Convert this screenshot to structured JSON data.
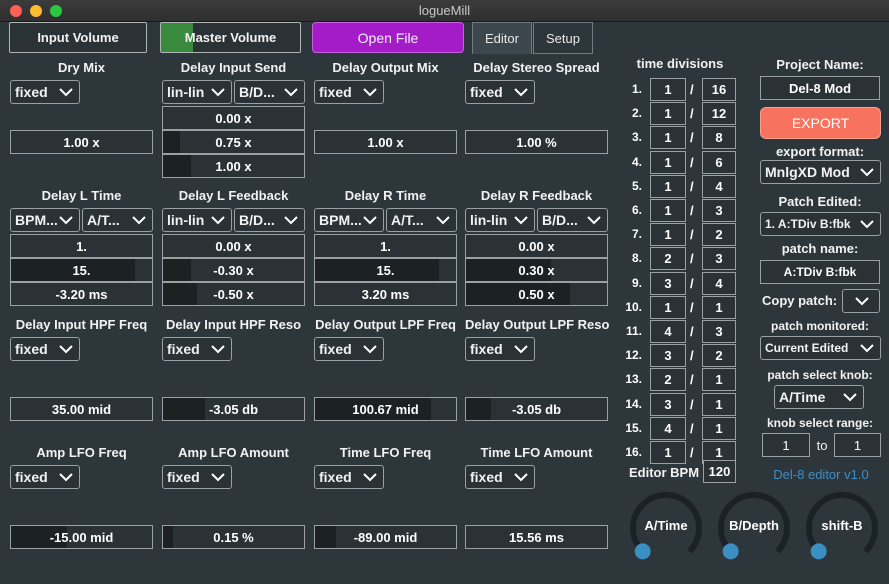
{
  "window": {
    "title": "logueMill"
  },
  "colors": {
    "open_file": "#a31cc8",
    "export": "#f7735e",
    "version": "#3d8ec9",
    "knob_dot": "#3b8fc2",
    "volume_fill": "#3a8a3e"
  },
  "toolbar": {
    "input_volume": "Input Volume",
    "master_volume": "Master Volume",
    "master_volume_level": 0.23,
    "open_file": "Open File",
    "tabs": [
      "Editor",
      "Setup"
    ]
  },
  "params": {
    "dry_mix": {
      "label": "Dry Mix",
      "mode": "fixed",
      "value": "1.00 x"
    },
    "delay_input_send": {
      "label": "Delay Input Send",
      "mode": "lin-lin",
      "mode2": "B/D...",
      "values": [
        "0.00 x",
        "0.75 x",
        "1.00 x"
      ],
      "levels": [
        0.0,
        0.12,
        0.2
      ]
    },
    "delay_output_mix": {
      "label": "Delay Output Mix",
      "mode": "fixed",
      "value": "1.00 x"
    },
    "delay_stereo_spread": {
      "label": "Delay Stereo Spread",
      "mode": "fixed",
      "value": "1.00 %"
    },
    "delay_l_time": {
      "label": "Delay L Time",
      "mode": "BPM...",
      "mode2": "A/T...",
      "values": [
        "1.",
        "15.",
        "-3.20 ms"
      ],
      "levels": [
        0.0,
        0.88,
        0.0
      ]
    },
    "delay_l_feedback": {
      "label": "Delay L Feedback",
      "mode": "lin-lin",
      "mode2": "B/D...",
      "values": [
        "0.00 x",
        "-0.30 x",
        "-0.50 x"
      ],
      "levels": [
        0.0,
        0.2,
        0.24
      ]
    },
    "delay_r_time": {
      "label": "Delay R Time",
      "mode": "BPM...",
      "mode2": "A/T...",
      "values": [
        "1.",
        "15.",
        "3.20 ms"
      ],
      "levels": [
        0.0,
        0.88,
        0.0
      ]
    },
    "delay_r_feedback": {
      "label": "Delay R Feedback",
      "mode": "lin-lin",
      "mode2": "B/D...",
      "values": [
        "0.00 x",
        "0.30 x",
        "0.50 x"
      ],
      "levels": [
        0.0,
        0.6,
        0.74
      ]
    },
    "delay_input_hpf_freq": {
      "label": "Delay Input HPF Freq",
      "mode": "fixed",
      "value": "35.00 mid"
    },
    "delay_input_hpf_reso": {
      "label": "Delay Input HPF Reso",
      "mode": "fixed",
      "value": "-3.05 db"
    },
    "delay_output_lpf_freq": {
      "label": "Delay Output LPF Freq",
      "mode": "fixed",
      "value": "100.67 mid"
    },
    "delay_output_lpf_reso": {
      "label": "Delay Output LPF Reso",
      "mode": "fixed",
      "value": "-3.05 db"
    },
    "amp_lfo_freq": {
      "label": "Amp LFO Freq",
      "mode": "fixed",
      "value": "-15.00 mid"
    },
    "amp_lfo_amount": {
      "label": "Amp LFO Amount",
      "mode": "fixed",
      "value": "0.15 %"
    },
    "time_lfo_freq": {
      "label": "Time LFO Freq",
      "mode": "fixed",
      "value": "-89.00 mid"
    },
    "time_lfo_amount": {
      "label": "Time LFO Amount",
      "mode": "fixed",
      "value": "15.56 ms"
    }
  },
  "time_divisions": {
    "label": "time divisions",
    "rows": [
      {
        "idx": "1.",
        "num": "1",
        "den": "16"
      },
      {
        "idx": "2.",
        "num": "1",
        "den": "12"
      },
      {
        "idx": "3.",
        "num": "1",
        "den": "8"
      },
      {
        "idx": "4.",
        "num": "1",
        "den": "6"
      },
      {
        "idx": "5.",
        "num": "1",
        "den": "4"
      },
      {
        "idx": "6.",
        "num": "1",
        "den": "3"
      },
      {
        "idx": "7.",
        "num": "1",
        "den": "2"
      },
      {
        "idx": "8.",
        "num": "2",
        "den": "3"
      },
      {
        "idx": "9.",
        "num": "3",
        "den": "4"
      },
      {
        "idx": "10.",
        "num": "1",
        "den": "1"
      },
      {
        "idx": "11.",
        "num": "4",
        "den": "3"
      },
      {
        "idx": "12.",
        "num": "3",
        "den": "2"
      },
      {
        "idx": "13.",
        "num": "2",
        "den": "1"
      },
      {
        "idx": "14.",
        "num": "3",
        "den": "1"
      },
      {
        "idx": "15.",
        "num": "4",
        "den": "1"
      },
      {
        "idx": "16.",
        "num": "1",
        "den": "1"
      }
    ],
    "slash": "/",
    "editor_bpm_label": "Editor BPM",
    "editor_bpm": "120"
  },
  "right_panel": {
    "project_name_label": "Project Name:",
    "project_name": "Del-8 Mod",
    "export": "EXPORT",
    "export_format_label": "export format:",
    "export_format": "MnlgXD Mod",
    "patch_edited_label": "Patch Edited:",
    "patch_edited": "1. A:TDiv B:fbk",
    "patch_name_label": "patch name:",
    "patch_name": "A:TDiv B:fbk",
    "copy_patch_label": "Copy patch:",
    "patch_monitored_label": "patch monitored:",
    "patch_monitored": "Current Edited",
    "patch_select_knob_label": "patch select knob:",
    "patch_select_knob": "A/Time",
    "knob_select_range_label": "knob select range:",
    "range_from": "1",
    "range_to_label": "to",
    "range_to": "1",
    "version": "Del-8 editor v1.0"
  },
  "knobs": [
    {
      "label": "A/Time",
      "value": 0.0
    },
    {
      "label": "B/Depth",
      "value": 0.0
    },
    {
      "label": "shift-B",
      "value": 0.0
    }
  ]
}
